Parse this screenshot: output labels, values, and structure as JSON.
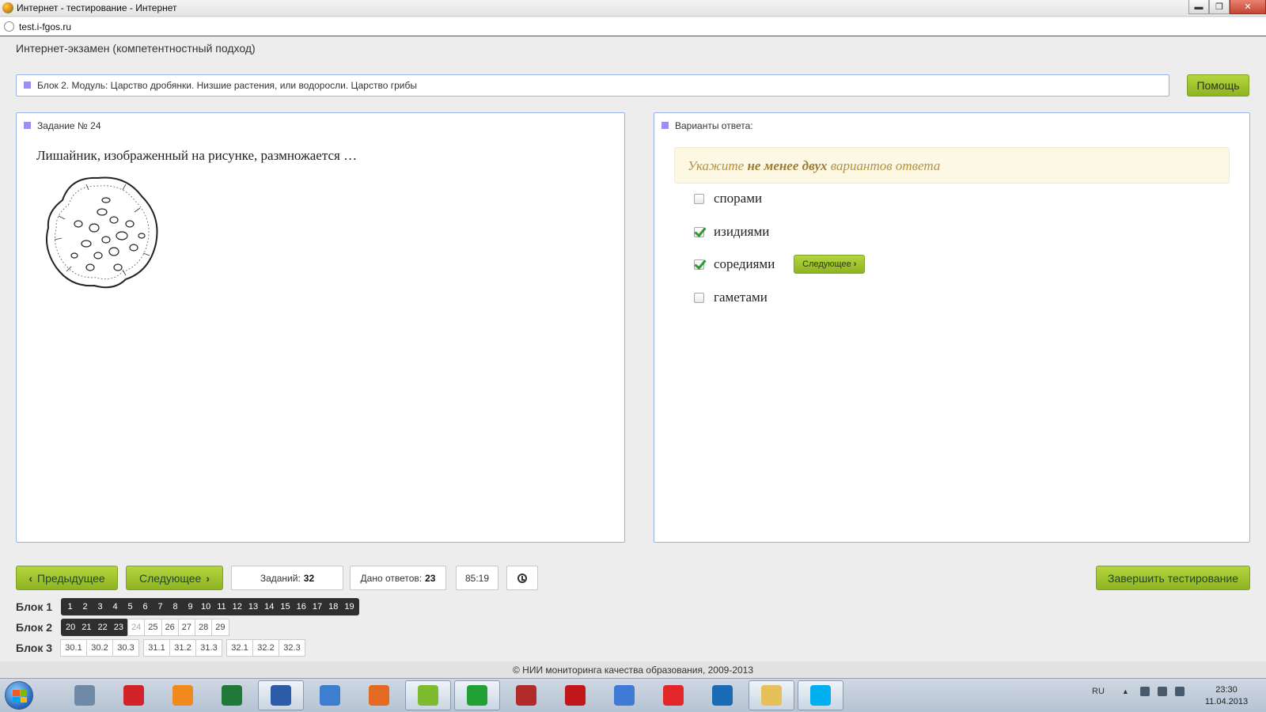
{
  "window": {
    "title": "Интернет - тестирование - Интернет",
    "url": "test.i-fgos.ru",
    "min": "▬",
    "max": "❐",
    "close": "✕"
  },
  "header": {
    "app_title": "Интернет-экзамен (компетентностный подход)",
    "block_title": "Блок 2. Модуль: Царство дробянки. Низшие растения, или водоросли. Царство грибы",
    "help_label": "Помощь"
  },
  "question": {
    "header": "Задание № 24",
    "text": "Лишайник, изображенный на рисунке, размножается …"
  },
  "answers": {
    "header": "Варианты ответа:",
    "hint_pre": "Укажите ",
    "hint_bold": "не менее двух",
    "hint_post": " вариантов ответа",
    "options": [
      {
        "label": "спорами",
        "checked": false
      },
      {
        "label": "изидиями",
        "checked": true
      },
      {
        "label": "соредиями",
        "checked": true
      },
      {
        "label": "гаметами",
        "checked": false
      }
    ],
    "inline_next": "Следующее"
  },
  "nav": {
    "prev_label": "Предыдущее",
    "next_label": "Следующее",
    "tasks_label": "Заданий:",
    "tasks_count": "32",
    "answered_label": "Дано ответов:",
    "answered_count": "23",
    "timer": "85:19",
    "finish_label": "Завершить тестирование"
  },
  "blocks": [
    {
      "label": "Блок 1",
      "dark": [
        "1",
        "2",
        "3",
        "4",
        "5",
        "6",
        "7",
        "8",
        "9",
        "10",
        "11",
        "12",
        "13",
        "14",
        "15",
        "16",
        "17",
        "18",
        "19"
      ],
      "light": []
    },
    {
      "label": "Блок 2",
      "dark": [
        "20",
        "21",
        "22",
        "23"
      ],
      "current": "24",
      "light": [
        "25",
        "26",
        "27",
        "28",
        "29"
      ]
    },
    {
      "label": "Блок 3",
      "groups": [
        [
          "30.1",
          "30.2",
          "30.3"
        ],
        [
          "31.1",
          "31.2",
          "31.3"
        ],
        [
          "32.1",
          "32.2",
          "32.3"
        ]
      ]
    }
  ],
  "footer": "© НИИ мониторинга качества образования, 2009-2013",
  "taskbar": {
    "lang": "RU",
    "time": "23:30",
    "date": "11.04.2013",
    "tray_arrow": "▲",
    "icons": [
      "calculator-icon",
      "kaspersky-icon",
      "media-player-icon",
      "excel-icon",
      "word-icon",
      "paint-icon",
      "archive-icon",
      "browser-icon",
      "mail-agent-icon",
      "opera-icon",
      "pdf-icon",
      "email-icon",
      "yandex-icon",
      "hp-icon",
      "explorer-icon",
      "skype-icon"
    ],
    "colors": {
      "calculator-icon": "#6e8aa6",
      "kaspersky-icon": "#d2232a",
      "media-player-icon": "#f08a1c",
      "excel-icon": "#1f7a3a",
      "word-icon": "#2b5ba8",
      "paint-icon": "#3c7fd0",
      "archive-icon": "#e36a20",
      "browser-icon": "#7dbb2f",
      "mail-agent-icon": "#21a035",
      "opera-icon": "#b22b2b",
      "pdf-icon": "#c0171b",
      "email-icon": "#3e7ad6",
      "yandex-icon": "#e2262a",
      "hp-icon": "#1a6bb5",
      "explorer-icon": "#e6c15a",
      "skype-icon": "#00aff0"
    }
  }
}
